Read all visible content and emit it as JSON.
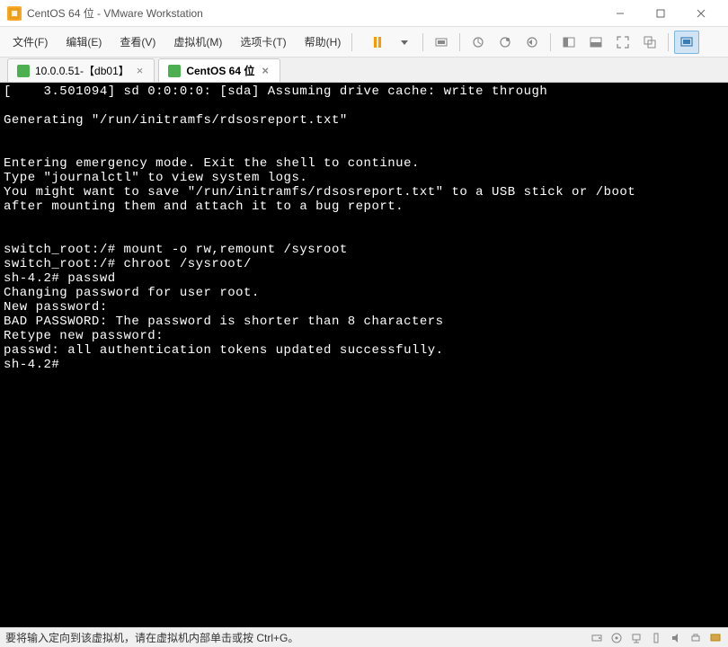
{
  "window": {
    "title": "CentOS 64 位 - VMware Workstation"
  },
  "menubar": {
    "items": [
      "文件(F)",
      "编辑(E)",
      "查看(V)",
      "虚拟机(M)",
      "选项卡(T)",
      "帮助(H)"
    ]
  },
  "tabs": [
    {
      "label": "10.0.0.51-【db01】",
      "active": false
    },
    {
      "label": "CentOS 64 位",
      "active": true
    }
  ],
  "terminal": {
    "lines": [
      "[    3.501094] sd 0:0:0:0: [sda] Assuming drive cache: write through",
      "",
      "Generating \"/run/initramfs/rdsosreport.txt\"",
      "",
      "",
      "Entering emergency mode. Exit the shell to continue.",
      "Type \"journalctl\" to view system logs.",
      "You might want to save \"/run/initramfs/rdsosreport.txt\" to a USB stick or /boot",
      "after mounting them and attach it to a bug report.",
      "",
      "",
      "switch_root:/# mount -o rw,remount /sysroot",
      "switch_root:/# chroot /sysroot/",
      "sh-4.2# passwd",
      "Changing password for user root.",
      "New password:",
      "BAD PASSWORD: The password is shorter than 8 characters",
      "Retype new password:",
      "passwd: all authentication tokens updated successfully.",
      "sh-4.2#"
    ]
  },
  "statusbar": {
    "text": "要将输入定向到该虚拟机，请在虚拟机内部单击或按 Ctrl+G。"
  }
}
